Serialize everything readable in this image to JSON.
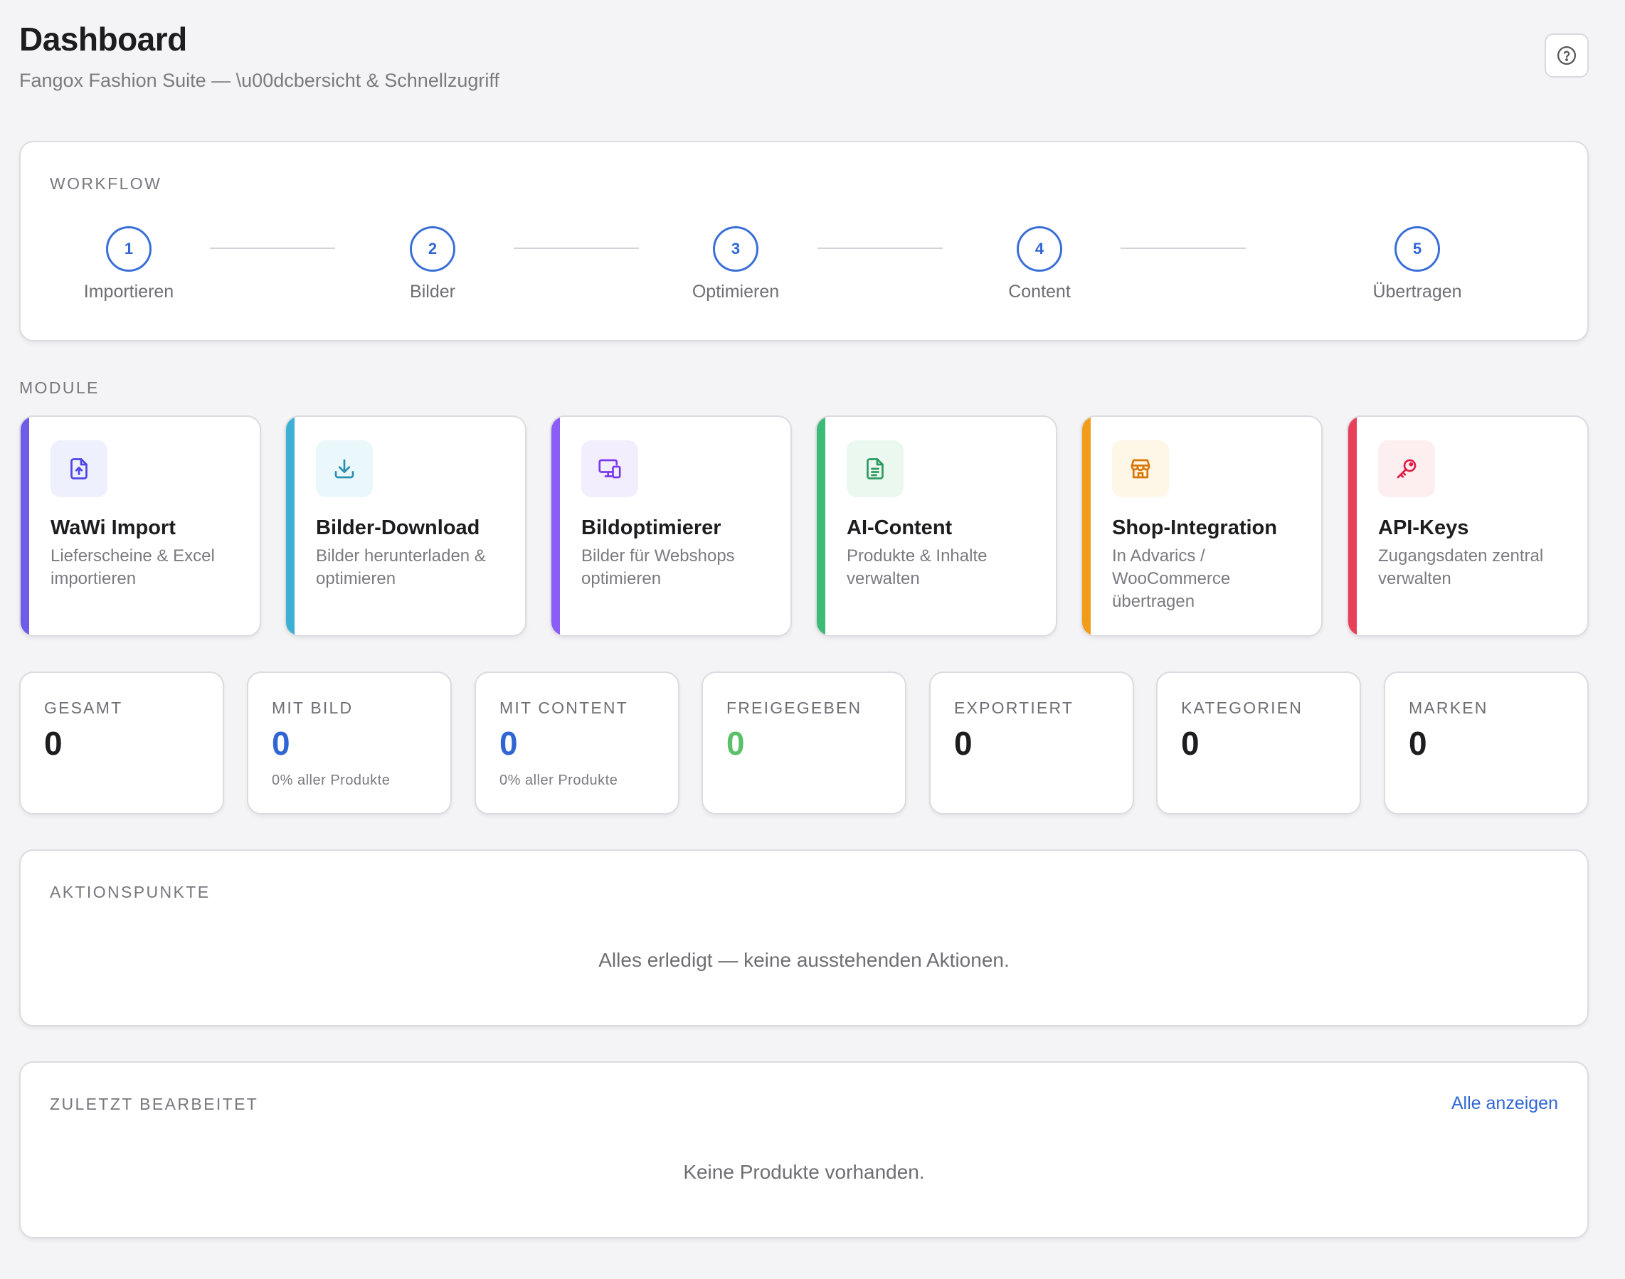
{
  "header": {
    "title": "Dashboard",
    "subtitle": "Fangox Fashion Suite — \\u00dcbersicht & Schnellzugriff",
    "help_icon": "question-circle-icon"
  },
  "workflow": {
    "label": "WORKFLOW",
    "steps": [
      {
        "number": "1",
        "label": "Importieren"
      },
      {
        "number": "2",
        "label": "Bilder"
      },
      {
        "number": "3",
        "label": "Optimieren"
      },
      {
        "number": "4",
        "label": "Content"
      },
      {
        "number": "5",
        "label": "Übertragen"
      }
    ],
    "accent_color": "#3a6fd8"
  },
  "modules": {
    "label": "MODULE",
    "items": [
      {
        "title": "WaWi Import",
        "description": "Lieferscheine & Excel importieren",
        "icon": "file-upload-icon",
        "accent": "#6c5ce7",
        "icon_bg": "#eef0fd",
        "icon_color": "#4f46e5"
      },
      {
        "title": "Bilder-Download",
        "description": "Bilder herunterladen & optimieren",
        "icon": "download-icon",
        "accent": "#3bafd4",
        "icon_bg": "#eaf7fb",
        "icon_color": "#2a8fb0"
      },
      {
        "title": "Bildoptimierer",
        "description": "Bilder für Webshops optimieren",
        "icon": "devices-icon",
        "accent": "#8b5cf6",
        "icon_bg": "#f3eefe",
        "icon_color": "#7c3aed"
      },
      {
        "title": "AI-Content",
        "description": "Produkte & Inhalte verwalten",
        "icon": "document-icon",
        "accent": "#3dba78",
        "icon_bg": "#eaf8f0",
        "icon_color": "#2f9a60"
      },
      {
        "title": "Shop-Integration",
        "description": "In Advarics / WooCommerce übertragen",
        "icon": "store-icon",
        "accent": "#f29d1a",
        "icon_bg": "#fef6e6",
        "icon_color": "#d97706"
      },
      {
        "title": "API-Keys",
        "description": "Zugangsdaten zentral verwalten",
        "icon": "key-icon",
        "accent": "#e8405a",
        "icon_bg": "#fdeef0",
        "icon_color": "#e11d48"
      }
    ]
  },
  "stats": [
    {
      "label": "GESAMT",
      "value": "0",
      "sub": "",
      "color": "#1d1d1f"
    },
    {
      "label": "MIT BILD",
      "value": "0",
      "sub": "0% aller Produkte",
      "color": "#2f66d4"
    },
    {
      "label": "MIT CONTENT",
      "value": "0",
      "sub": "0% aller Produkte",
      "color": "#2f66d4"
    },
    {
      "label": "FREIGEGEBEN",
      "value": "0",
      "sub": "",
      "color": "#5cc069"
    },
    {
      "label": "EXPORTIERT",
      "value": "0",
      "sub": "",
      "color": "#1d1d1f"
    },
    {
      "label": "KATEGORIEN",
      "value": "0",
      "sub": "",
      "color": "#1d1d1f"
    },
    {
      "label": "MARKEN",
      "value": "0",
      "sub": "",
      "color": "#1d1d1f"
    }
  ],
  "actions": {
    "label": "AKTIONSPUNKTE",
    "empty": "Alles erledigt — keine ausstehenden Aktionen."
  },
  "recent": {
    "label": "ZULETZT BEARBEITET",
    "show_all": "Alle anzeigen",
    "empty": "Keine Produkte vorhanden."
  }
}
